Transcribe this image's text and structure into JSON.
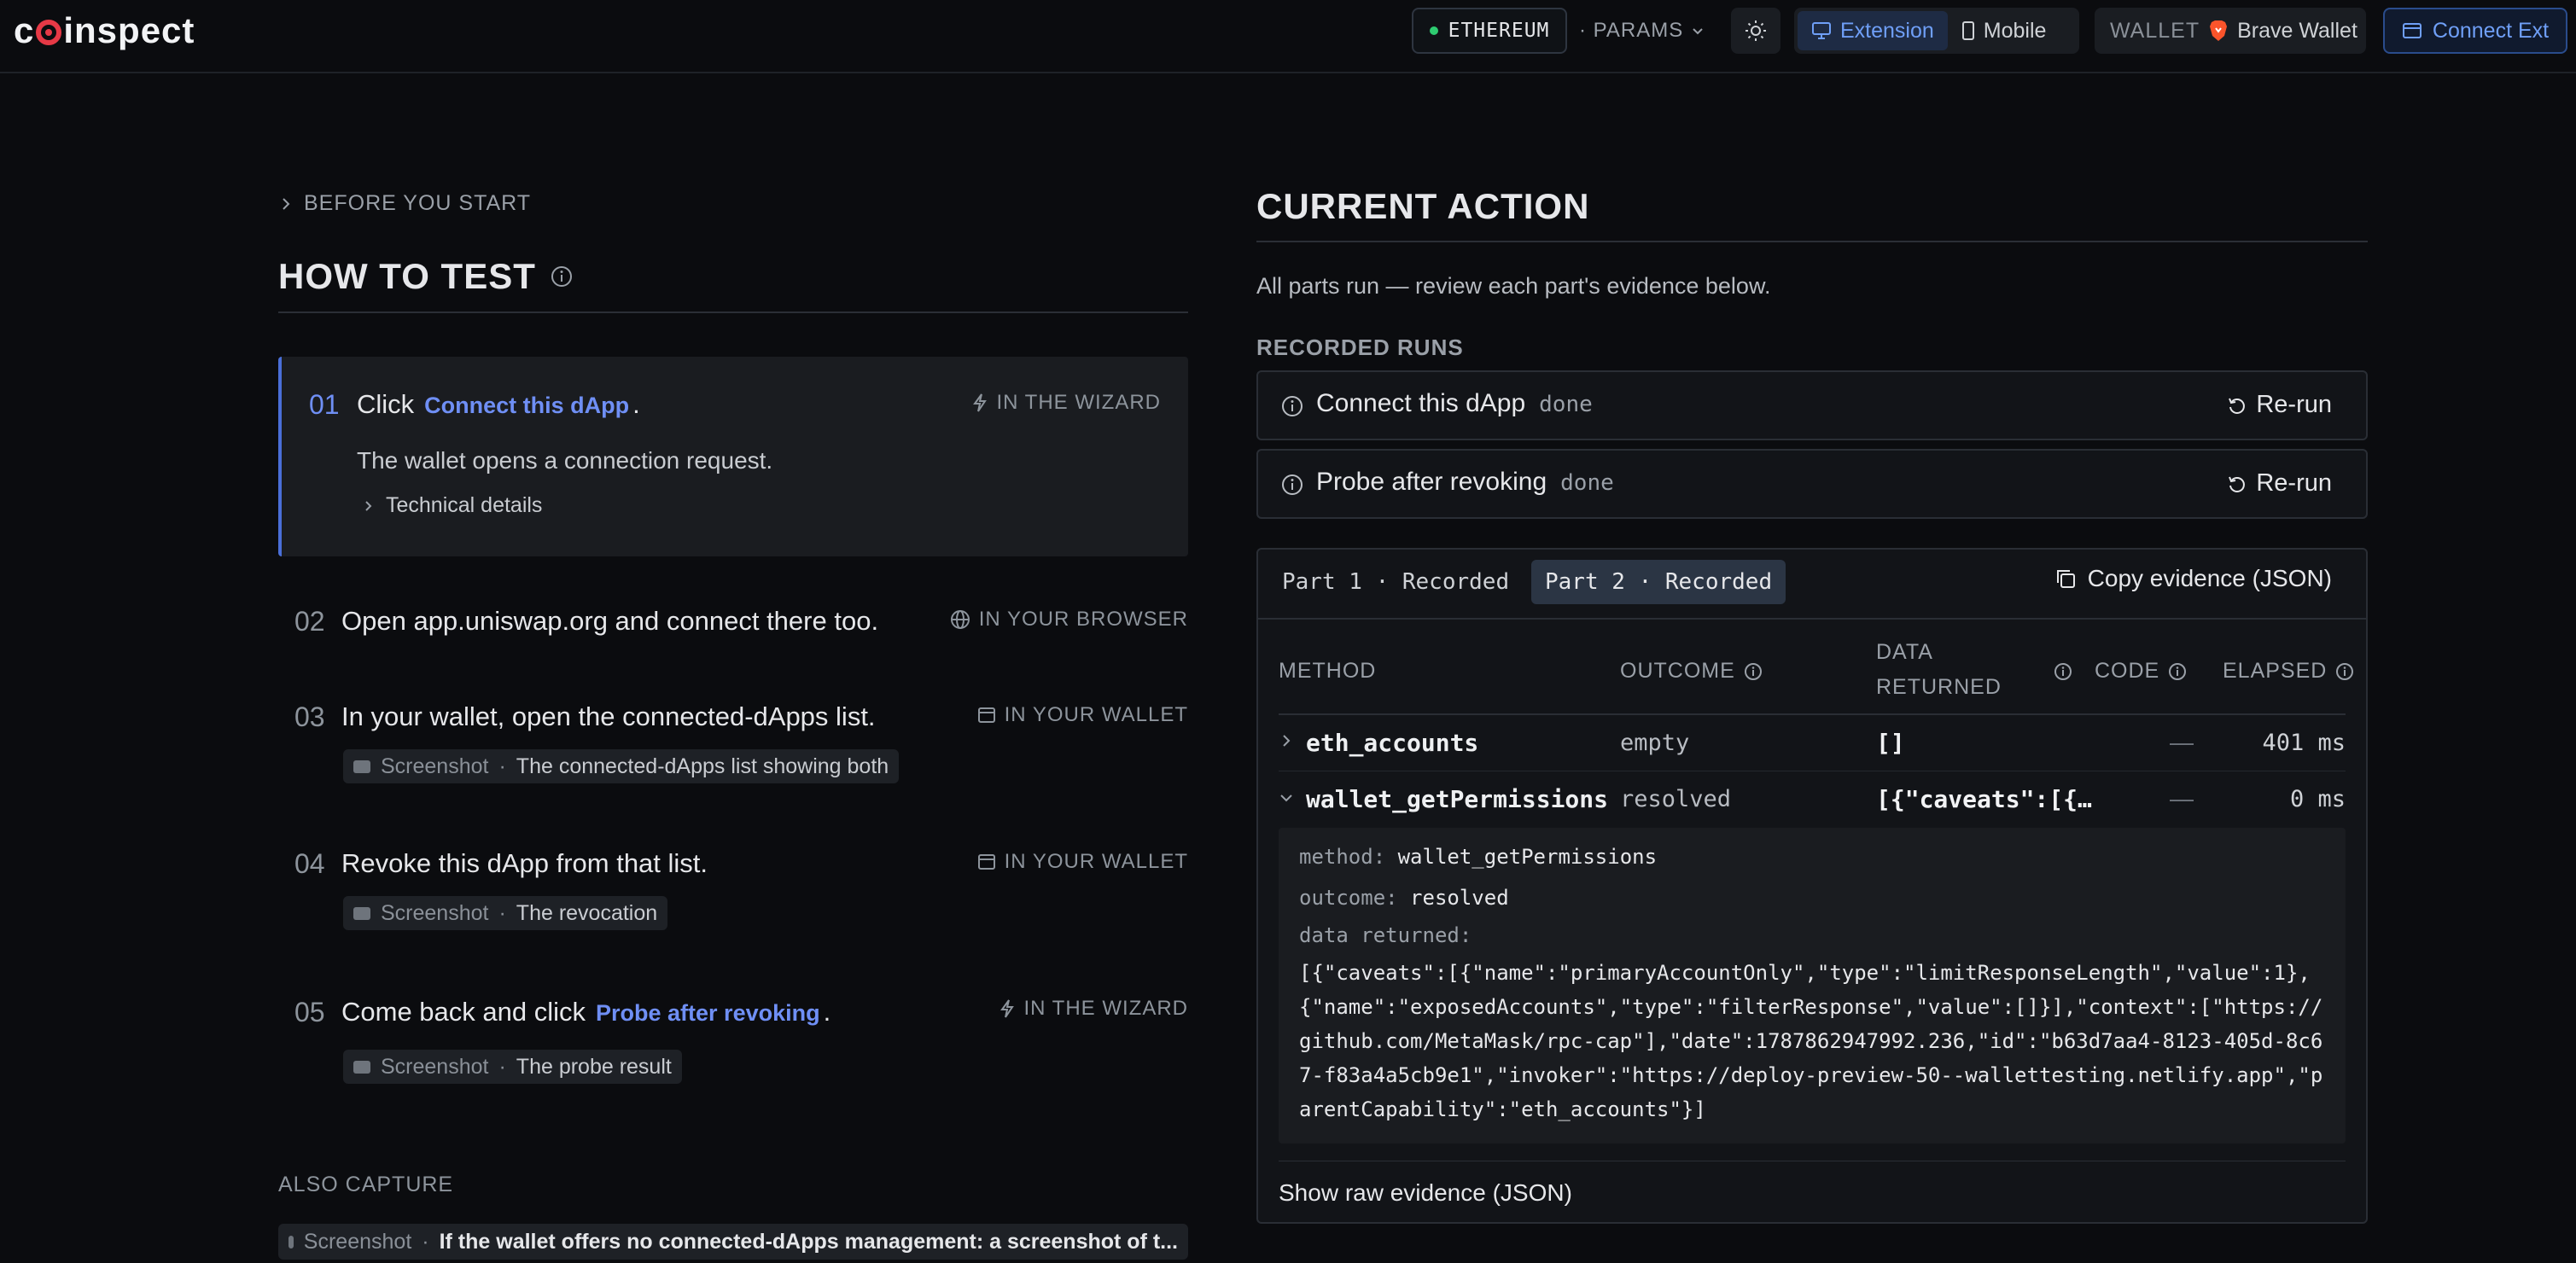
{
  "app": {
    "logo_text": "coinspect"
  },
  "topbar": {
    "network": "ETHEREUM",
    "params": "· PARAMS",
    "modes": {
      "extension": "Extension",
      "mobile": "Mobile"
    },
    "wallet_label": "WALLET",
    "wallet_name": "Brave Wallet",
    "connect_label": "Connect Ext"
  },
  "left": {
    "before": "BEFORE YOU START",
    "howto": "HOW TO TEST",
    "steps": [
      {
        "num": "01",
        "text": "Click",
        "link": "Connect this dApp",
        "suffix": ".",
        "where": "IN THE WIZARD",
        "desc": "The wallet opens a connection request.",
        "tech": "Technical details"
      },
      {
        "num": "02",
        "text": "Open app.uniswap.org and connect there too.",
        "where": "IN YOUR BROWSER"
      },
      {
        "num": "03",
        "text": "In your wallet, open the connected-dApps list.",
        "where": "IN YOUR WALLET",
        "chip_k": "Screenshot",
        "chip_v": "The connected-dApps list showing both"
      },
      {
        "num": "04",
        "text": "Revoke this dApp from that list.",
        "where": "IN YOUR WALLET",
        "chip_k": "Screenshot",
        "chip_v": "The revocation"
      },
      {
        "num": "05",
        "text": "Come back and click",
        "link": "Probe after revoking",
        "suffix": ".",
        "where": "IN THE WIZARD",
        "chip_k": "Screenshot",
        "chip_v": "The probe result"
      }
    ],
    "also_label": "ALSO CAPTURE",
    "also_chip_k": "Screenshot",
    "also_chip_v": "If the wallet offers no connected-dApps management: a screenshot of t..."
  },
  "right": {
    "title": "CURRENT ACTION",
    "subtitle": "All parts run — review each part's evidence below.",
    "runs_label": "RECORDED RUNS",
    "runs": [
      {
        "name": "Connect this dApp",
        "status": "done",
        "rerun": "Re-run"
      },
      {
        "name": "Probe after revoking",
        "status": "done",
        "rerun": "Re-run"
      }
    ],
    "tabs": [
      "Part 1 · Recorded",
      "Part 2 · Recorded"
    ],
    "copy_evidence": "Copy evidence (JSON)",
    "columns": {
      "method": "METHOD",
      "outcome": "OUTCOME",
      "data_1": "DATA",
      "data_2": "RETURNED",
      "code": "CODE",
      "elapsed": "ELAPSED"
    },
    "rows": [
      {
        "method": "eth_accounts",
        "outcome": "empty",
        "data": "[]",
        "code": "—",
        "elapsed": "401 ms"
      },
      {
        "method": "wallet_getPermissions",
        "outcome": "resolved",
        "data": "[{\"caveats\":[{…",
        "code": "—",
        "elapsed": "0 ms"
      }
    ],
    "detail": {
      "method_k": "method:",
      "method_v": "wallet_getPermissions",
      "outcome_k": "outcome:",
      "outcome_v": "resolved",
      "data_k": "data returned:",
      "data_v": "[{\"caveats\":[{\"name\":\"primaryAccountOnly\",\"type\":\"limitResponseLength\",\"value\":1},{\"name\":\"exposedAccounts\",\"type\":\"filterResponse\",\"value\":[]}],\"context\":[\"https://github.com/MetaMask/rpc-cap\"],\"date\":1787862947992.236,\"id\":\"b63d7aa4-8123-405d-8c67-f83a4a5cb9e1\",\"invoker\":\"https://deploy-preview-50--wallettesting.netlify.app\",\"parentCapability\":\"eth_accounts\"}]"
    },
    "raw_link": "Show raw evidence (JSON)"
  }
}
